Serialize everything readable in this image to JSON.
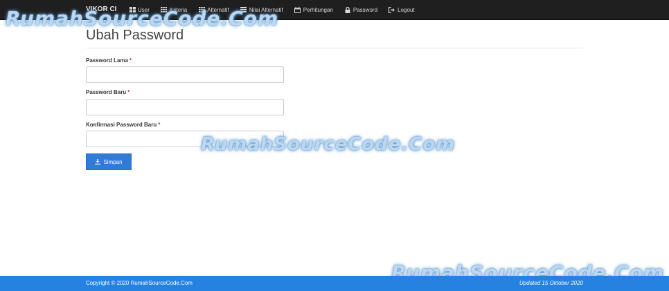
{
  "navbar": {
    "brand": "VIKOR CI",
    "items": [
      {
        "label": "User",
        "icon": "grid-icon"
      },
      {
        "label": "Kriteria",
        "icon": "grid-icon"
      },
      {
        "label": "Alternatif",
        "icon": "grid-icon"
      },
      {
        "label": "Nilai Alternatif",
        "icon": "list-icon"
      },
      {
        "label": "Perhitungan",
        "icon": "calendar-icon"
      },
      {
        "label": "Password",
        "icon": "lock-icon"
      },
      {
        "label": "Logout",
        "icon": "logout-icon"
      }
    ]
  },
  "watermark": "RumahSourceCode.Com",
  "page": {
    "title": "Ubah Password"
  },
  "form": {
    "required_mark": "*",
    "fields": [
      {
        "label": "Password Lama",
        "value": ""
      },
      {
        "label": "Password Baru",
        "value": ""
      },
      {
        "label": "Konfirmasi Password Baru",
        "value": ""
      }
    ],
    "save_label": "Simpan"
  },
  "footer": {
    "copyright": "Copyright © 2020 RumahSourceCode.Com",
    "updated": "Updated 15 Oktober 2020"
  },
  "colors": {
    "navbar_bg": "#1f1f1f",
    "primary": "#2f7bd6",
    "footer_bg": "#2582e0",
    "required": "#c9302c"
  }
}
